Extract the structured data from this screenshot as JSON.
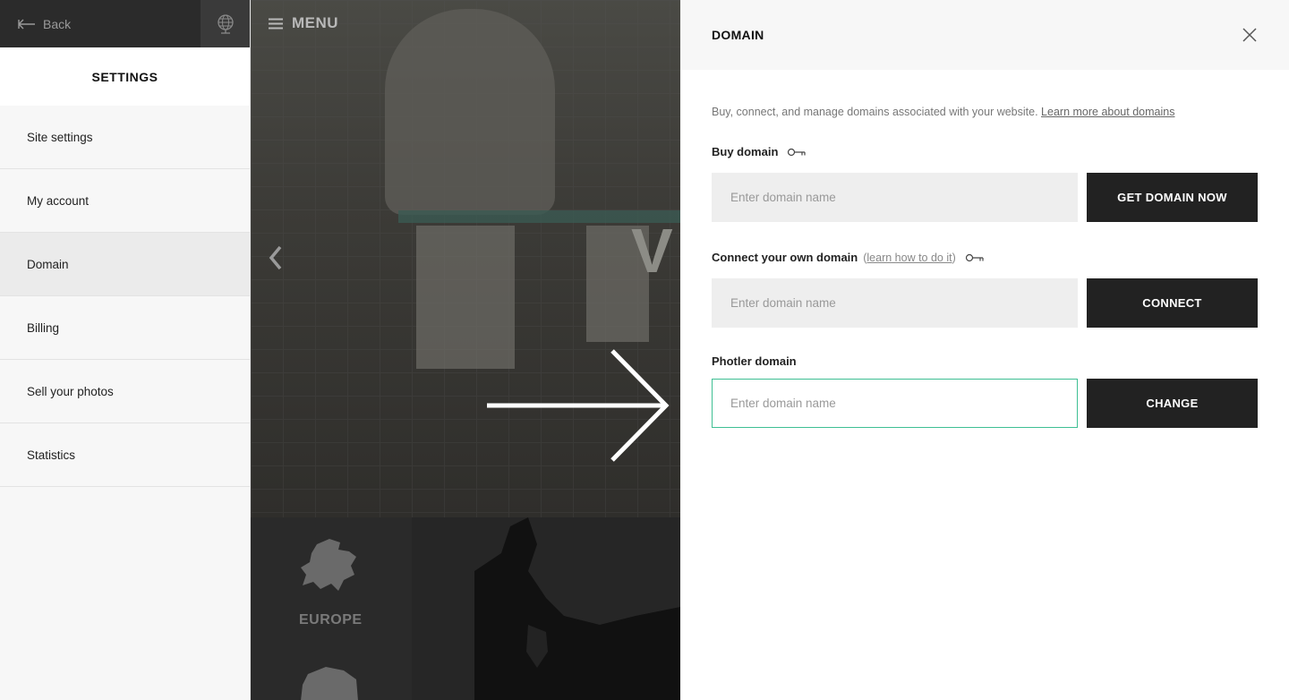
{
  "sidebar": {
    "back_label": "Back",
    "title": "SETTINGS",
    "items": [
      {
        "label": "Site settings"
      },
      {
        "label": "My account"
      },
      {
        "label": "Domain",
        "active": true
      },
      {
        "label": "Billing"
      },
      {
        "label": "Sell your photos"
      },
      {
        "label": "Statistics"
      }
    ]
  },
  "preview": {
    "menu_label": "MENU",
    "slide_letter": "V",
    "map_label": "EUROPE"
  },
  "domain_panel": {
    "title": "DOMAIN",
    "intro_text": "Buy, connect, and manage domains associated with your website.",
    "intro_link": "Learn more about domains",
    "buy": {
      "label": "Buy domain",
      "placeholder": "Enter domain name",
      "button": "GET DOMAIN NOW"
    },
    "connect": {
      "label": "Connect your own domain",
      "help_open": "(",
      "help_link": "learn how to do it",
      "help_close": ")",
      "placeholder": "Enter domain name",
      "button": "CONNECT"
    },
    "photler": {
      "label": "Photler domain",
      "placeholder": "Enter domain name",
      "button": "CHANGE"
    }
  },
  "colors": {
    "focus_border": "#3ebf93",
    "button_bg": "#222222"
  }
}
